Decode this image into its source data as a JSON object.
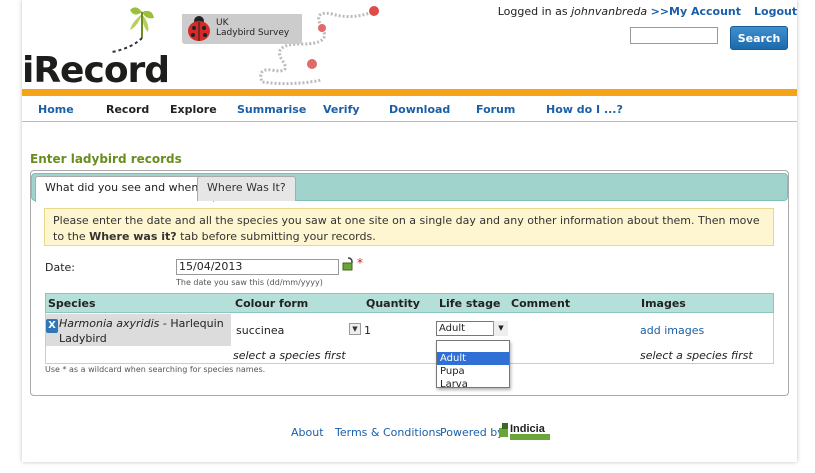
{
  "header": {
    "logo_text": "iRecord",
    "survey_line1": "UK",
    "survey_line2": "Ladybird Survey",
    "logged_in_prefix": "Logged in as ",
    "username": "johnvanbreda",
    "my_account_label": ">>My Account",
    "logout_label": "Logout",
    "search_value": "",
    "search_button_label": "Search"
  },
  "nav": {
    "items": [
      {
        "label": "Home"
      },
      {
        "label": "Record"
      },
      {
        "label": "Explore"
      },
      {
        "label": "Summarise"
      },
      {
        "label": "Verify"
      },
      {
        "label": "Download"
      },
      {
        "label": "Forum"
      },
      {
        "label": "How do I ...?"
      }
    ]
  },
  "main": {
    "heading": "Enter ladybird records",
    "tabs": [
      {
        "label": "What did you see and when?",
        "active": true
      },
      {
        "label": "Where Was It?",
        "active": false
      }
    ],
    "info_part1": "Please enter the date and all the species you saw at one site on a single day and any other information about them. Then move to the ",
    "info_bold": "Where was it?",
    "info_part2": " tab before submitting your records.",
    "date_label": "Date:",
    "date_value": "15/04/2013",
    "date_hint": "The date you saw this (dd/mm/yyyy)",
    "required_marker": "*",
    "grid": {
      "columns": [
        "Species",
        "Colour form",
        "Quantity",
        "Life stage",
        "Comment",
        "Images"
      ],
      "row": {
        "remove_label": "X",
        "species_sci": "Harmonia axyridis",
        "species_common": " - Harlequin Ladybird",
        "colour_form": "succinea",
        "quantity": "1",
        "life_stage": "Adult",
        "comment": "",
        "images_link": "add images"
      },
      "empty_row_text": "select a species first",
      "life_stage_options": [
        "Adult",
        "Pupa",
        "Larva"
      ]
    },
    "wildcard_hint": "Use * as a wildcard when searching for species names."
  },
  "footer": {
    "about": "About",
    "terms": "Terms & Conditions",
    "powered_by": "Powered by",
    "indicia": "Indicia"
  },
  "colors": {
    "accent_orange": "#f7a31a",
    "link_blue": "#1a5fa8",
    "heading_green": "#6b8d1f",
    "tab_teal": "#9fd3cc"
  }
}
